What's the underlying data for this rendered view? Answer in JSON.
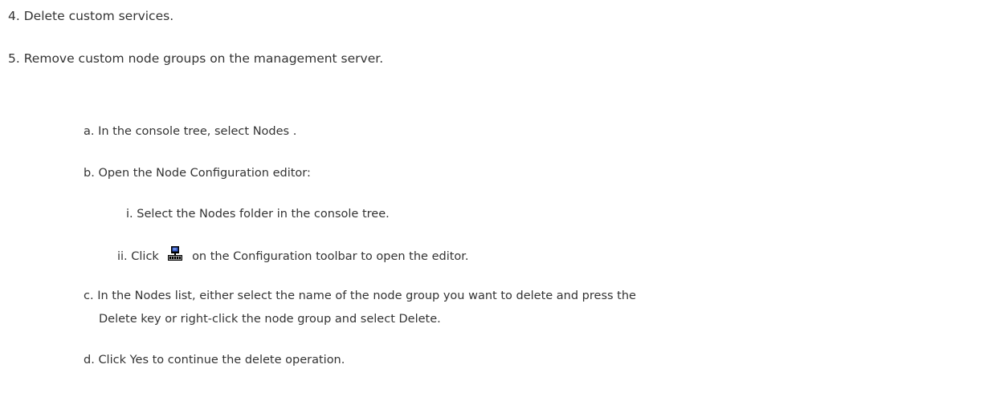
{
  "steps": [
    {
      "num": "4.",
      "text": "Delete custom services."
    },
    {
      "num": "5.",
      "text": "Remove custom node groups on the management server."
    }
  ],
  "substeps": {
    "a": {
      "num": "a.",
      "text": "In the console tree, select Nodes ."
    },
    "b": {
      "num": "b.",
      "text": "Open the Node Configuration editor:"
    },
    "b_i": {
      "num": "i.",
      "text": "Select the Nodes folder in the console tree."
    },
    "b_ii": {
      "num": "ii.",
      "before": "Click",
      "icon": "node-configuration-toolbar-icon",
      "after": "on the Configuration toolbar to open the editor."
    },
    "c": {
      "num": "c.",
      "line1": "In the Nodes list, either select the name of the node group you want to delete and press the",
      "line2": "Delete key or right-click the node group and select Delete."
    },
    "d": {
      "num": "d.",
      "text": "Click Yes to continue the delete operation."
    }
  }
}
